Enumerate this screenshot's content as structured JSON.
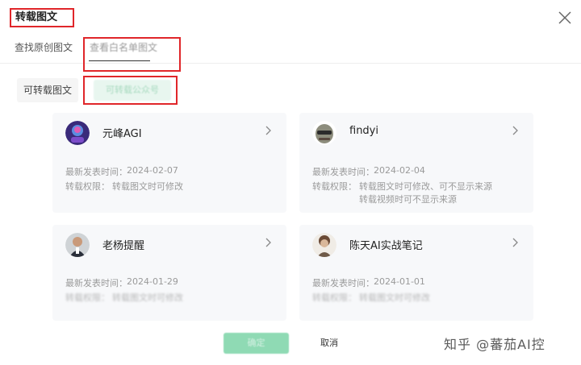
{
  "dialog": {
    "title": "转载图文"
  },
  "tabs": [
    {
      "label": "查找原创图文"
    },
    {
      "label": "查看白名单图文"
    }
  ],
  "subtabs": [
    {
      "label": "可转载图文"
    },
    {
      "label": "可转载公众号"
    }
  ],
  "cards": [
    {
      "name": "元峰AGI",
      "latest_label": "最新发表时间：",
      "latest": "2024-02-07",
      "perm_label": "转载权限：",
      "perms": [
        "转载图文时可修改"
      ]
    },
    {
      "name": "findyi",
      "latest_label": "最新发表时间：",
      "latest": "2024-02-04",
      "perm_label": "转载权限：",
      "perms": [
        "转载图文时可修改、可不显示来源",
        "转载视频时可不显示来源"
      ]
    },
    {
      "name": "老杨提醒",
      "latest_label": "最新发表时间：",
      "latest": "2024-01-29",
      "perm_label": "转载权限：",
      "perms": [
        "转载图文时可修改"
      ]
    },
    {
      "name": "陈天AI实战笔记",
      "latest_label": "最新发表时间：",
      "latest": "2024-01-01",
      "perm_label": "转载权限：",
      "perms": [
        "转载图文时可修改"
      ]
    }
  ],
  "footer": {
    "confirm_label": "确定",
    "cancel_label": "取消"
  },
  "watermark": "知乎 @蕃茄AI控",
  "colors": {
    "accent": "#07c160",
    "highlight_border": "#e0262a",
    "card_bg": "#f7f8fa"
  }
}
